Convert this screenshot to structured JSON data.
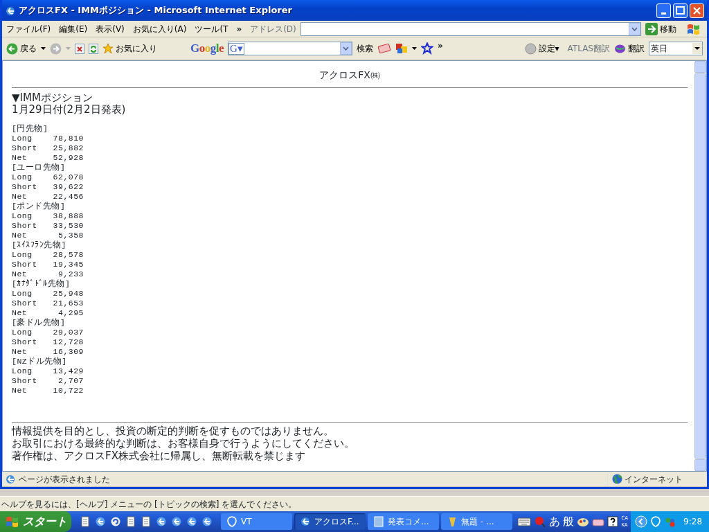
{
  "window": {
    "title": "アクロスFX - IMMポジション - Microsoft Internet Explorer"
  },
  "menu": [
    "ファイル(F)",
    "編集(E)",
    "表示(V)",
    "お気に入り(A)",
    "ツール(T"
  ],
  "menu_more": "»",
  "address": {
    "label": "アドレス(D)",
    "go": "移動"
  },
  "toolbar": {
    "back": "戻る",
    "favorites": "お気に入り",
    "google_logo": "Google",
    "google_button": "G▾",
    "search": "検索",
    "more": "»",
    "settings": "設定▾",
    "atlas": "ATLAS翻訳",
    "translate": "翻訳",
    "language": "英日"
  },
  "page": {
    "title": "アクロスFX㈱",
    "heading": "▼IMMポジション",
    "date": "1月29日付(2月2日発表)",
    "sections": [
      {
        "label": "[円先物]",
        "rows": [
          {
            "label": "Long",
            "value": "78,810"
          },
          {
            "label": "Short",
            "value": "25,882"
          },
          {
            "label": "Net",
            "value": "52,928"
          }
        ]
      },
      {
        "label": "[ユーロ先物]",
        "rows": [
          {
            "label": "Long",
            "value": "62,078"
          },
          {
            "label": "Short",
            "value": "39,622"
          },
          {
            "label": "Net",
            "value": "22,456"
          }
        ]
      },
      {
        "label": "[ポンド先物]",
        "rows": [
          {
            "label": "Long",
            "value": "38,888"
          },
          {
            "label": "Short",
            "value": "33,530"
          },
          {
            "label": "Net",
            "value": "5,358"
          }
        ]
      },
      {
        "label": "[ｽｲｽﾌﾗﾝ先物]",
        "rows": [
          {
            "label": "Long",
            "value": "28,578"
          },
          {
            "label": "Short",
            "value": "19,345"
          },
          {
            "label": "Net",
            "value": "9,233"
          }
        ]
      },
      {
        "label": "[ｶﾅﾀﾞﾄﾞﾙ先物]",
        "rows": [
          {
            "label": "Long",
            "value": "25,948"
          },
          {
            "label": "Short",
            "value": "21,653"
          },
          {
            "label": "Net",
            "value": "4,295"
          }
        ]
      },
      {
        "label": "[豪ドル先物]",
        "rows": [
          {
            "label": "Long",
            "value": "29,037"
          },
          {
            "label": "Short",
            "value": "12,728"
          },
          {
            "label": "Net",
            "value": "16,309"
          }
        ]
      },
      {
        "label": "[NZドル先物]",
        "rows": [
          {
            "label": "Long",
            "value": "13,429"
          },
          {
            "label": "Short",
            "value": "2,707"
          },
          {
            "label": "Net",
            "value": "10,722"
          }
        ]
      }
    ],
    "disclaimer": [
      "情報提供を目的とし、投資の断定的判断を促すものではありません。",
      "お取引における最終的な判断は、お客様自身で行うようにしてください。",
      "著作権は、アクロスFX株式会社に帰属し、無断転載を禁じます"
    ]
  },
  "status_bar": {
    "text": "ページが表示されました",
    "zone": "インターネット"
  },
  "background_status": "ヘルプを見るには、[ヘルプ] メニューの [トピックの検索] を選んでください。",
  "taskbar": {
    "start": "スタート",
    "tasks": [
      {
        "label": "VT",
        "selected": false
      },
      {
        "label": "アクロスF...",
        "selected": true
      },
      {
        "label": "発表コメ...",
        "selected": false
      },
      {
        "label": "無題 - ...",
        "selected": false
      }
    ],
    "ime": [
      "あ",
      "般"
    ],
    "locks": [
      "CA",
      "KA"
    ],
    "clock": "9:28"
  }
}
